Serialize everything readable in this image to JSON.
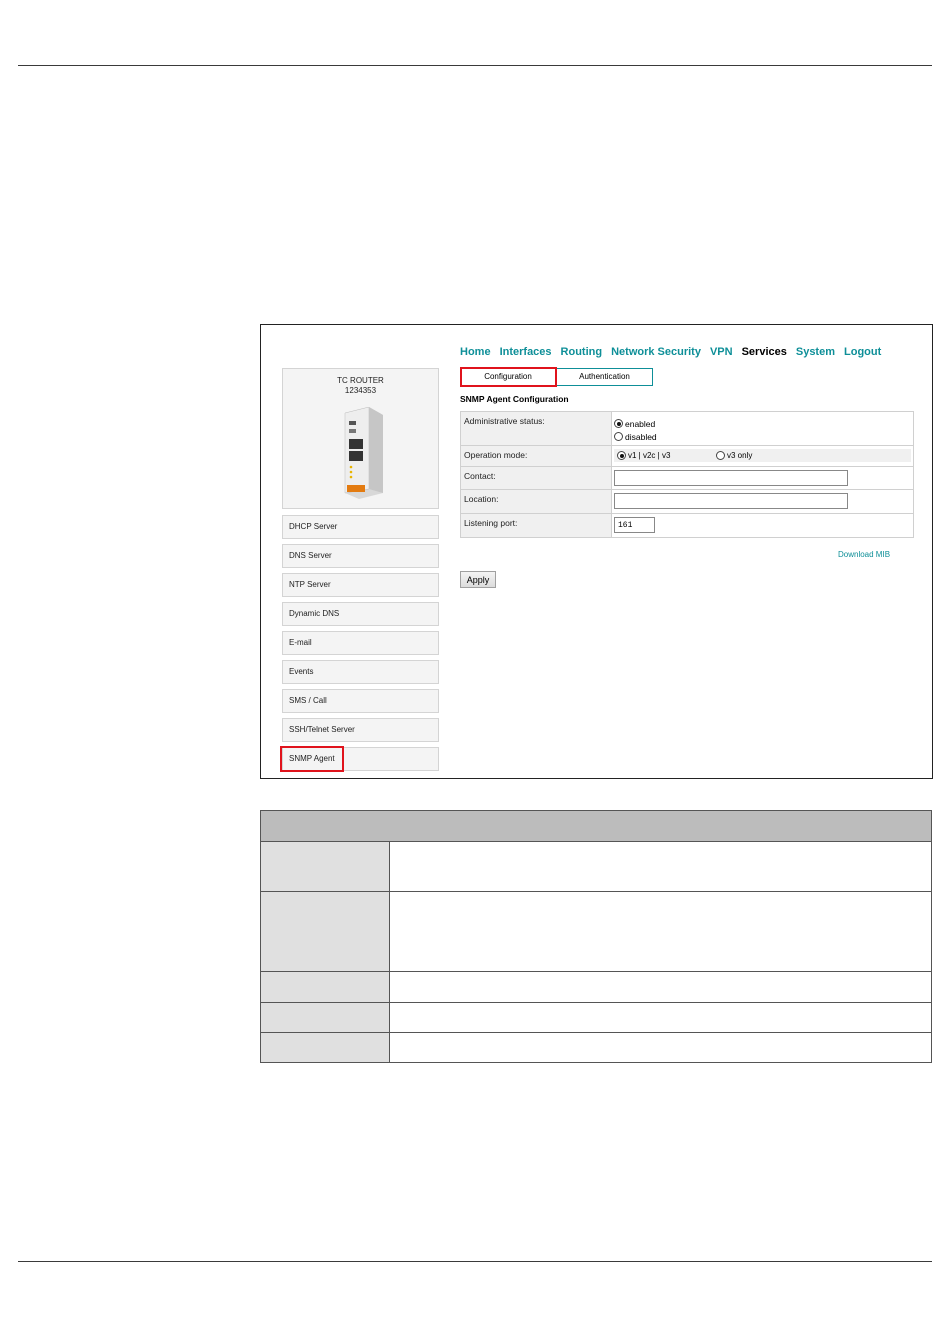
{
  "nav": {
    "items": [
      {
        "label": "Home",
        "active": false
      },
      {
        "label": "Interfaces",
        "active": false
      },
      {
        "label": "Routing",
        "active": false
      },
      {
        "label": "Network Security",
        "active": false
      },
      {
        "label": "VPN",
        "active": false
      },
      {
        "label": "Services",
        "active": true
      },
      {
        "label": "System",
        "active": false
      },
      {
        "label": "Logout",
        "active": false
      }
    ]
  },
  "product": {
    "name": "TC ROUTER",
    "number": "1234353"
  },
  "sidebar": {
    "items": [
      {
        "label": "DHCP Server"
      },
      {
        "label": "DNS Server"
      },
      {
        "label": "NTP Server"
      },
      {
        "label": "Dynamic DNS"
      },
      {
        "label": "E-mail"
      },
      {
        "label": "Events"
      },
      {
        "label": "SMS / Call"
      },
      {
        "label": "SSH/Telnet Server"
      },
      {
        "label": "SNMP Agent"
      }
    ],
    "selected": "SNMP Agent"
  },
  "tabs": {
    "configuration": "Configuration",
    "authentication": "Authentication",
    "active": "Configuration"
  },
  "form": {
    "title": "SNMP Agent Configuration",
    "admin_status": {
      "label": "Administrative status:",
      "options": [
        "enabled",
        "disabled"
      ],
      "selected": "enabled"
    },
    "operation_mode": {
      "label": "Operation mode:",
      "options": [
        "v1 | v2c | v3",
        "v3 only"
      ],
      "selected": "v1 | v2c | v3"
    },
    "contact": {
      "label": "Contact:",
      "value": ""
    },
    "location": {
      "label": "Location:",
      "value": ""
    },
    "listening_port": {
      "label": "Listening port:",
      "value": "161"
    }
  },
  "download_mib": "Download MIB",
  "apply_label": "Apply",
  "colors": {
    "link": "#0e8f98",
    "highlight": "#e0131c"
  }
}
